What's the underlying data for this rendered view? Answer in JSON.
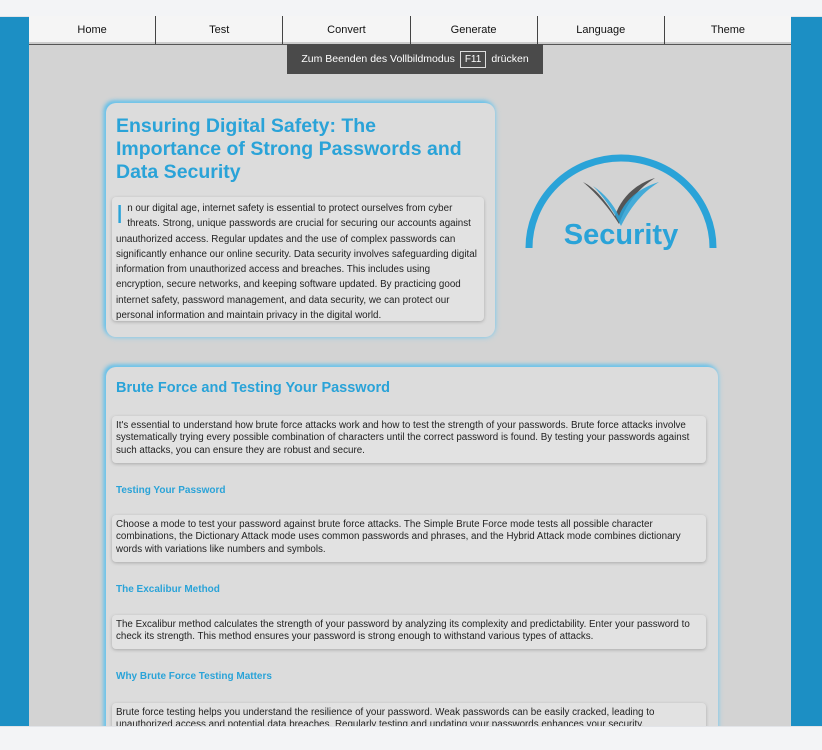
{
  "nav": {
    "items": [
      {
        "label": "Home"
      },
      {
        "label": "Test"
      },
      {
        "label": "Convert"
      },
      {
        "label": "Generate"
      },
      {
        "label": "Language"
      },
      {
        "label": "Theme"
      }
    ]
  },
  "fullscreen_banner": {
    "text_before": "Zum Beenden des Vollbildmodus",
    "key": "F11",
    "text_after": "drücken"
  },
  "intro": {
    "title": "Ensuring Digital Safety: The Importance of Strong Passwords and Data Security",
    "dropcap": "I",
    "body": "n our digital age, internet safety is essential to protect ourselves from cyber threats. Strong, unique passwords are crucial for securing our accounts against unauthorized access. Regular updates and the use of complex passwords can significantly enhance our online security. Data security involves safeguarding digital information from unauthorized access and breaches. This includes using encryption, secure networks, and keeping software updated. By practicing good internet safety, password management, and data security, we can protect our personal information and maintain privacy in the digital world."
  },
  "logo": {
    "text": "Security",
    "icon": "swoosh-v-logo",
    "colors": {
      "arc": "#2aa3d8",
      "text": "#2aa3d8",
      "swoosh_dark": "#555555"
    }
  },
  "brute_force": {
    "title": "Brute Force and Testing Your Password",
    "intro": "It's essential to understand how brute force attacks work and how to test the strength of your passwords. Brute force attacks involve systematically trying every possible combination of characters until the correct password is found. By testing your passwords against such attacks, you can ensure they are robust and secure.",
    "sections": [
      {
        "title": "Testing Your Password",
        "body": "Choose a mode to test your password against brute force attacks. The Simple Brute Force mode tests all possible character combinations, the Dictionary Attack mode uses common passwords and phrases, and the Hybrid Attack mode combines dictionary words with variations like numbers and symbols."
      },
      {
        "title": "The Excalibur Method",
        "body": "The Excalibur method calculates the strength of your password by analyzing its complexity and predictability. Enter your password to check its strength. This method ensures your password is strong enough to withstand various types of attacks."
      },
      {
        "title": "Why Brute Force Testing Matters",
        "body": "Brute force testing helps you understand the resilience of your password. Weak passwords can be easily cracked, leading to unauthorized access and potential data breaches. Regularly testing and updating your passwords enhances your security."
      }
    ]
  },
  "colors": {
    "accent": "#2aa3d8",
    "frame": "#1c8fc4",
    "page_bg": "#d3d3d3"
  }
}
